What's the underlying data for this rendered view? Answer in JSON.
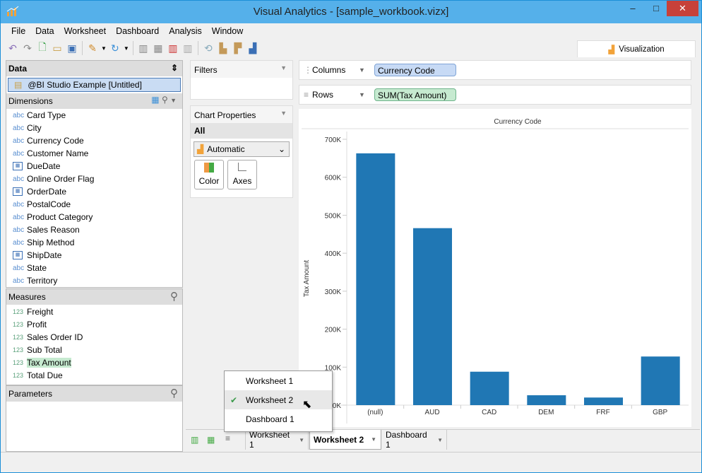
{
  "window": {
    "title": "Visual Analytics - [sample_workbook.vizx]",
    "min": "–",
    "max": "□",
    "close": "✕"
  },
  "menu": [
    "File",
    "Data",
    "Worksheet",
    "Dashboard",
    "Analysis",
    "Window"
  ],
  "toolbar": {
    "icons": [
      "undo-icon",
      "redo-icon",
      "new-icon",
      "open-icon",
      "save-icon",
      "connect-icon",
      "refresh-icon",
      "add-worksheet-icon",
      "add-dashboard-icon",
      "delete-worksheet-icon",
      "clear-icon",
      "swap-icon",
      "sort-asc-icon",
      "sort-desc-icon",
      "fit-icon"
    ]
  },
  "vis_tab": "Visualization",
  "data_panel": {
    "title": "Data",
    "source": "@BI Studio Example [Untitled]",
    "dimensions_label": "Dimensions",
    "dimensions": [
      {
        "t": "abc",
        "n": "Card Type"
      },
      {
        "t": "abc",
        "n": "City"
      },
      {
        "t": "abc",
        "n": "Currency Code"
      },
      {
        "t": "abc",
        "n": "Customer Name"
      },
      {
        "t": "date",
        "n": "DueDate"
      },
      {
        "t": "abc",
        "n": "Online Order Flag"
      },
      {
        "t": "date",
        "n": "OrderDate"
      },
      {
        "t": "abc",
        "n": "PostalCode"
      },
      {
        "t": "abc",
        "n": "Product Category"
      },
      {
        "t": "abc",
        "n": "Sales Reason"
      },
      {
        "t": "abc",
        "n": "Ship Method"
      },
      {
        "t": "date",
        "n": "ShipDate"
      },
      {
        "t": "abc",
        "n": "State"
      },
      {
        "t": "abc",
        "n": "Territory"
      }
    ],
    "measures_label": "Measures",
    "measures": [
      "Freight",
      "Profit",
      "Sales Order ID",
      "Sub Total",
      "Tax Amount",
      "Total Due"
    ],
    "selected_measure": "Tax Amount",
    "parameters_label": "Parameters",
    "abc": "abc",
    "n123": "123"
  },
  "filters": {
    "title": "Filters"
  },
  "chart_props": {
    "title": "Chart Properties",
    "all": "All",
    "mark_type": "Automatic",
    "color": "Color",
    "axes": "Axes"
  },
  "shelves": {
    "columns_label": "Columns",
    "columns_pill": "Currency Code",
    "rows_label": "Rows",
    "rows_pill": "SUM(Tax Amount)"
  },
  "chart_data": {
    "type": "bar",
    "title": "Currency Code",
    "xlabel": "",
    "ylabel": "Tax Amount",
    "categories": [
      "(null)",
      "AUD",
      "CAD",
      "DEM",
      "FRF",
      "GBP"
    ],
    "values": [
      663000,
      466000,
      88000,
      26000,
      20000,
      128000
    ],
    "ylim": [
      0,
      700000
    ],
    "yticks": [
      "0K",
      "100K",
      "200K",
      "300K",
      "400K",
      "500K",
      "600K",
      "700K"
    ],
    "color": "#2077b4",
    "grid": false
  },
  "sheet_tabs": [
    {
      "label": "Worksheet 1",
      "active": false
    },
    {
      "label": "Worksheet 2",
      "active": true
    },
    {
      "label": "Dashboard 1",
      "active": false
    }
  ],
  "popup_menu": {
    "items": [
      "Worksheet 1",
      "Worksheet 2",
      "Dashboard 1"
    ],
    "checked": "Worksheet 2",
    "check": "✔"
  }
}
